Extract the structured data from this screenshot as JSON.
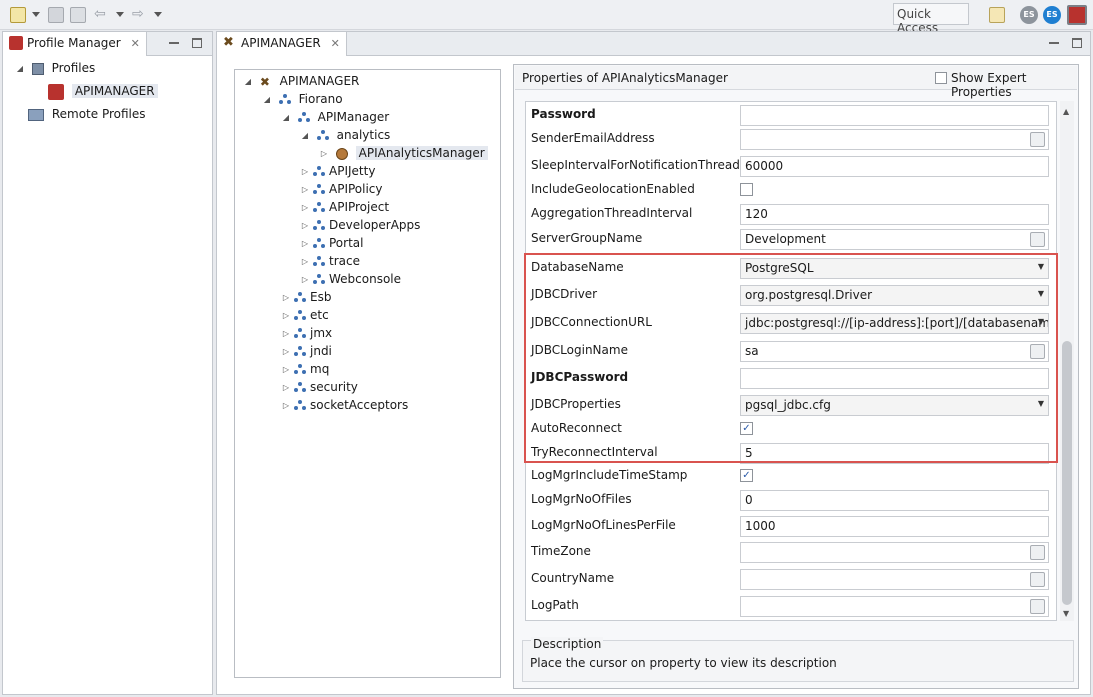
{
  "toolbar": {
    "quick_access": "Quick Access"
  },
  "profile_manager": {
    "tab_label": "Profile Manager",
    "tree": {
      "profiles": "Profiles",
      "apimanager": "APIMANAGER",
      "remote_profiles": "Remote Profiles"
    }
  },
  "apimanager_view": {
    "tab_label": "APIMANAGER",
    "tree": {
      "root": "APIMANAGER",
      "fiorano": "Fiorano",
      "apimanager": "APIManager",
      "analytics": "analytics",
      "api_analytics_manager": "APIAnalyticsManager",
      "apimanager_children": [
        "APIJetty",
        "APIPolicy",
        "APIProject",
        "DeveloperApps",
        "Portal",
        "trace",
        "Webconsole"
      ],
      "fiorano_children": [
        "Esb",
        "etc",
        "jmx",
        "jndi",
        "mq",
        "security",
        "socketAcceptors"
      ]
    }
  },
  "properties": {
    "title": "Properties of APIAnalyticsManager",
    "show_expert": "Show Expert Properties",
    "rows": [
      {
        "name": "Password",
        "bold": true,
        "type": "text",
        "value": ""
      },
      {
        "name": "SenderEmailAddress",
        "type": "ellipsis",
        "value": ""
      },
      {
        "name": "SleepIntervalForNotificationThread",
        "type": "text",
        "value": "60000"
      },
      {
        "name": "IncludeGeolocationEnabled",
        "type": "check",
        "checked": false
      },
      {
        "name": "AggregationThreadInterval",
        "type": "text",
        "value": "120"
      },
      {
        "name": "ServerGroupName",
        "type": "ellipsis",
        "value": "Development"
      },
      {
        "name": "DatabaseName",
        "type": "combo",
        "value": "PostgreSQL"
      },
      {
        "name": "JDBCDriver",
        "type": "combo",
        "value": "org.postgresql.Driver"
      },
      {
        "name": "JDBCConnectionURL",
        "type": "combo",
        "value": "jdbc:postgresql://[ip-address]:[port]/[databasename]"
      },
      {
        "name": "JDBCLoginName",
        "type": "ellipsis",
        "value": "sa"
      },
      {
        "name": "JDBCPassword",
        "bold": true,
        "type": "text",
        "value": ""
      },
      {
        "name": "JDBCProperties",
        "type": "combo",
        "value": "pgsql_jdbc.cfg"
      },
      {
        "name": "AutoReconnect",
        "type": "check",
        "checked": true
      },
      {
        "name": "TryReconnectInterval",
        "type": "text",
        "value": "5"
      },
      {
        "name": "LogMgrIncludeTimeStamp",
        "type": "check",
        "checked": true
      },
      {
        "name": "LogMgrNoOfFiles",
        "type": "text",
        "value": "0"
      },
      {
        "name": "LogMgrNoOfLinesPerFile",
        "type": "text",
        "value": "1000"
      },
      {
        "name": "TimeZone",
        "type": "ellipsis",
        "value": ""
      },
      {
        "name": "CountryName",
        "type": "ellipsis",
        "value": ""
      },
      {
        "name": "LogPath",
        "type": "ellipsis",
        "value": ""
      }
    ]
  },
  "description": {
    "title": "Description",
    "text": "Place the cursor on property to view its description"
  },
  "colors": {
    "highlight": "#d9534f",
    "accent": "#3d6fb2"
  }
}
